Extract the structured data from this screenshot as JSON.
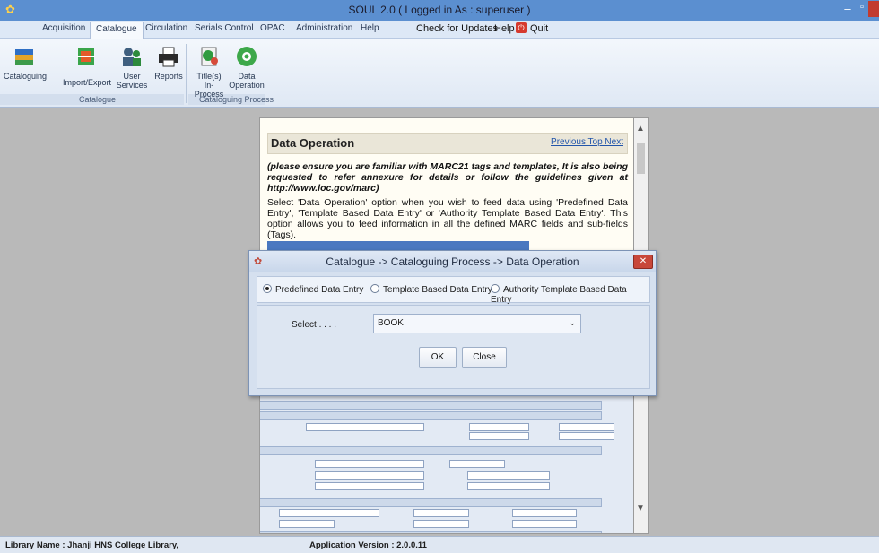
{
  "window": {
    "title": "SOUL 2.0  ( Logged in As : superuser )",
    "minimize_glyph": "–",
    "maximize_glyph": "▫",
    "app_icon": "app-icon"
  },
  "menu": {
    "tabs": [
      {
        "label": "Acquisition"
      },
      {
        "label": "Catalogue"
      },
      {
        "label": "Circulation"
      },
      {
        "label": "Serials Control"
      },
      {
        "label": "OPAC"
      },
      {
        "label": "Administration"
      },
      {
        "label": "Help"
      }
    ],
    "check_updates": "Check for Updates",
    "help": "Help",
    "quit": "Quit"
  },
  "ribbon": {
    "buttons": [
      {
        "label1": "Cataloguing",
        "label2": "",
        "icon": "books-icon"
      },
      {
        "label1": "Import/Export",
        "label2": "",
        "icon": "import-export-icon"
      },
      {
        "label1": "User",
        "label2": "Services",
        "icon": "user-services-icon"
      },
      {
        "label1": "Reports",
        "label2": "",
        "icon": "printer-icon"
      },
      {
        "label1": "Title(s) In-",
        "label2": "Process",
        "icon": "in-process-icon"
      },
      {
        "label1": "Data",
        "label2": "Operation",
        "icon": "data-operation-icon"
      }
    ],
    "groups": [
      "Catalogue",
      "Cataloguing Process"
    ]
  },
  "doc": {
    "heading": "Data Operation",
    "nav": "Previous Top Next",
    "note": "(please ensure you are familiar with MARC21 tags and templates, It is also being requested to refer annexure for details or follow the guidelines given at http://www.loc.gov/marc)",
    "body": "Select 'Data Operation' option when you wish to feed data using 'Predefined Data Entry', 'Template Based Data Entry' or 'Authority Template Based Data Entry'. This option allows you to feed information in all the defined MARC fields and sub-fields (Tags)."
  },
  "dialog": {
    "title": "Catalogue -> Cataloguing Process -> Data Operation",
    "close_glyph": "✕",
    "radios": [
      {
        "label": "Predefined Data Entry",
        "selected": true
      },
      {
        "label": "Template Based Data Entry",
        "selected": false
      },
      {
        "label": "Authority Template Based Data Entry",
        "selected": false
      }
    ],
    "select_label": "Select . . . .",
    "select_value": "BOOK",
    "ok": "OK",
    "close": "Close"
  },
  "status": {
    "library": "Library Name : Jhanji HNS College Library,",
    "version": "Application Version : 2.0.0.11"
  }
}
